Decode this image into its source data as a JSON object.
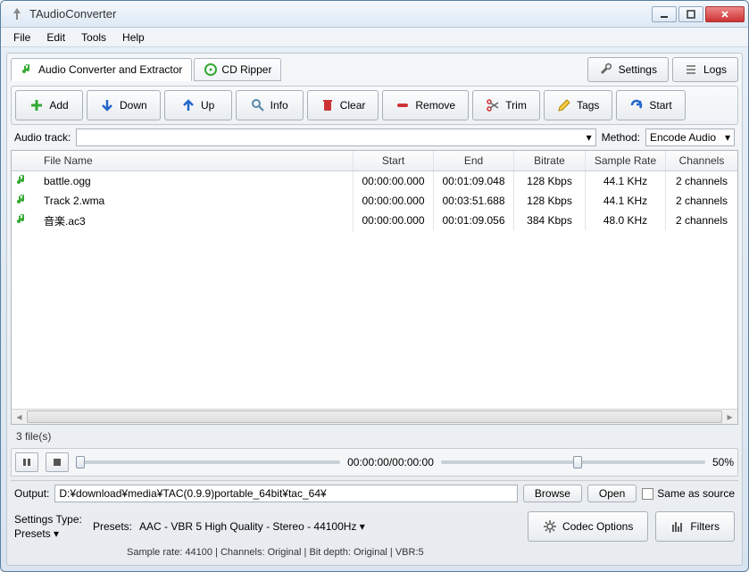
{
  "window": {
    "title": "TAudioConverter"
  },
  "menu": {
    "file": "File",
    "edit": "Edit",
    "tools": "Tools",
    "help": "Help"
  },
  "tabs": {
    "converter": "Audio Converter and Extractor",
    "ripper": "CD Ripper"
  },
  "topbtns": {
    "settings": "Settings",
    "logs": "Logs"
  },
  "toolbar": {
    "add": "Add",
    "down": "Down",
    "up": "Up",
    "info": "Info",
    "clear": "Clear",
    "remove": "Remove",
    "trim": "Trim",
    "tags": "Tags",
    "start": "Start"
  },
  "track": {
    "label": "Audio track:",
    "value": "",
    "method_label": "Method:",
    "method_value": "Encode Audio"
  },
  "columns": {
    "name": "File Name",
    "start": "Start",
    "end": "End",
    "bitrate": "Bitrate",
    "sr": "Sample Rate",
    "ch": "Channels"
  },
  "rows": [
    {
      "name": "battle.ogg",
      "start": "00:00:00.000",
      "end": "00:01:09.048",
      "bitrate": "128 Kbps",
      "sr": "44.1 KHz",
      "ch": "2 channels"
    },
    {
      "name": "Track 2.wma",
      "start": "00:00:00.000",
      "end": "00:03:51.688",
      "bitrate": "128 Kbps",
      "sr": "44.1 KHz",
      "ch": "2 channels"
    },
    {
      "name": "音楽.ac3",
      "start": "00:00:00.000",
      "end": "00:01:09.056",
      "bitrate": "384 Kbps",
      "sr": "48.0 KHz",
      "ch": "2 channels"
    }
  ],
  "status": {
    "count": "3 file(s)"
  },
  "player": {
    "time": "00:00:00/00:00:00",
    "vol": "50%"
  },
  "output": {
    "label": "Output:",
    "path": "D:¥download¥media¥TAC(0.9.9)portable_64bit¥tac_64¥",
    "browse": "Browse",
    "open": "Open",
    "same": "Same as source"
  },
  "settings": {
    "type_label": "Settings Type:",
    "type_value": "Presets",
    "presets_label": "Presets:",
    "presets_value": "AAC - VBR 5 High Quality - Stereo - 44100Hz",
    "codec": "Codec Options",
    "filters": "Filters",
    "info": "Sample rate: 44100 | Channels: Original | Bit depth: Original | VBR:5"
  }
}
